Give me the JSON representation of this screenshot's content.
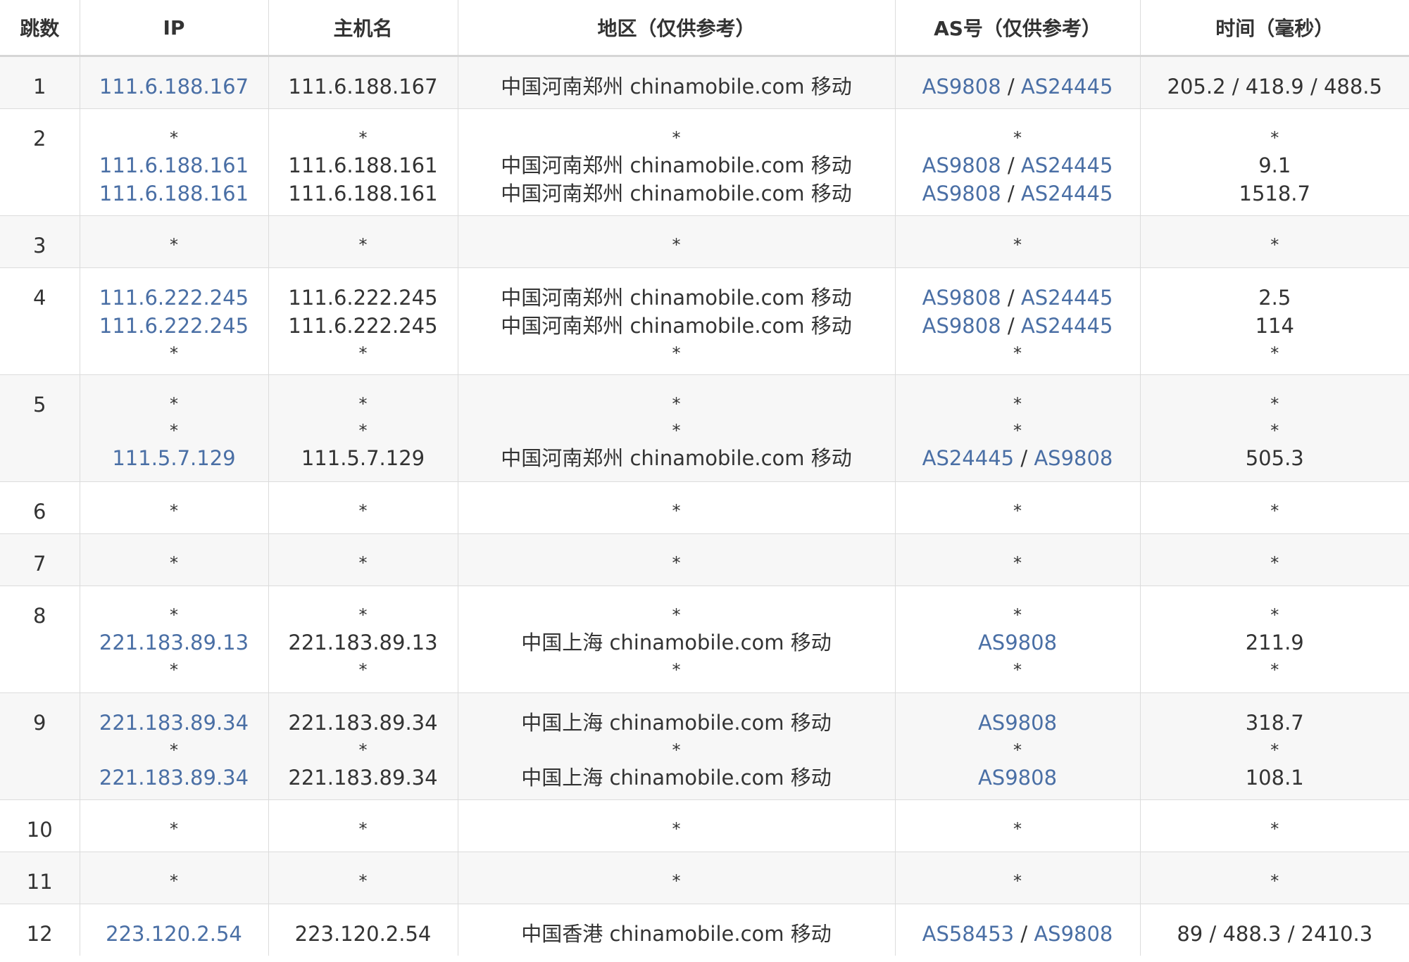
{
  "headers": {
    "hop": "跳数",
    "ip": "IP",
    "host": "主机名",
    "region": "地区（仅供参考）",
    "as": "AS号（仅供参考）",
    "time": "时间（毫秒）"
  },
  "colors": {
    "link": "#4a6fa5",
    "text": "#333333",
    "row_shade": "#f7f7f7",
    "border": "#dcdcdc"
  },
  "hops": [
    {
      "num": "1",
      "entries": [
        {
          "ip": "111.6.188.167",
          "host": "111.6.188.167",
          "region": "中国河南郑州 chinamobile.com 移动",
          "as": [
            "AS9808",
            "AS24445"
          ],
          "time": "205.2 / 418.9 / 488.5"
        }
      ]
    },
    {
      "num": "2",
      "entries": [
        {
          "ip": "*",
          "host": "*",
          "region": "*",
          "as": [],
          "time": "*"
        },
        {
          "ip": "111.6.188.161",
          "host": "111.6.188.161",
          "region": "中国河南郑州 chinamobile.com 移动",
          "as": [
            "AS9808",
            "AS24445"
          ],
          "time": "9.1"
        },
        {
          "ip": "111.6.188.161",
          "host": "111.6.188.161",
          "region": "中国河南郑州 chinamobile.com 移动",
          "as": [
            "AS9808",
            "AS24445"
          ],
          "time": "1518.7"
        }
      ]
    },
    {
      "num": "3",
      "entries": [
        {
          "ip": "*",
          "host": "*",
          "region": "*",
          "as": [],
          "time": "*"
        }
      ]
    },
    {
      "num": "4",
      "entries": [
        {
          "ip": "111.6.222.245",
          "host": "111.6.222.245",
          "region": "中国河南郑州 chinamobile.com 移动",
          "as": [
            "AS9808",
            "AS24445"
          ],
          "time": "2.5"
        },
        {
          "ip": "111.6.222.245",
          "host": "111.6.222.245",
          "region": "中国河南郑州 chinamobile.com 移动",
          "as": [
            "AS9808",
            "AS24445"
          ],
          "time": "114"
        },
        {
          "ip": "*",
          "host": "*",
          "region": "*",
          "as": [],
          "time": "*"
        }
      ]
    },
    {
      "num": "5",
      "entries": [
        {
          "ip": "*",
          "host": "*",
          "region": "*",
          "as": [],
          "time": "*"
        },
        {
          "ip": "*",
          "host": "*",
          "region": "*",
          "as": [],
          "time": "*"
        },
        {
          "ip": "111.5.7.129",
          "host": "111.5.7.129",
          "region": "中国河南郑州 chinamobile.com 移动",
          "as": [
            "AS24445",
            "AS9808"
          ],
          "time": "505.3"
        }
      ]
    },
    {
      "num": "6",
      "entries": [
        {
          "ip": "*",
          "host": "*",
          "region": "*",
          "as": [],
          "time": "*"
        }
      ]
    },
    {
      "num": "7",
      "entries": [
        {
          "ip": "*",
          "host": "*",
          "region": "*",
          "as": [],
          "time": "*"
        }
      ]
    },
    {
      "num": "8",
      "entries": [
        {
          "ip": "*",
          "host": "*",
          "region": "*",
          "as": [],
          "time": "*"
        },
        {
          "ip": "221.183.89.13",
          "host": "221.183.89.13",
          "region": "中国上海 chinamobile.com 移动",
          "as": [
            "AS9808"
          ],
          "time": "211.9"
        },
        {
          "ip": "*",
          "host": "*",
          "region": "*",
          "as": [],
          "time": "*"
        }
      ]
    },
    {
      "num": "9",
      "entries": [
        {
          "ip": "221.183.89.34",
          "host": "221.183.89.34",
          "region": "中国上海 chinamobile.com 移动",
          "as": [
            "AS9808"
          ],
          "time": "318.7"
        },
        {
          "ip": "*",
          "host": "*",
          "region": "*",
          "as": [],
          "time": "*"
        },
        {
          "ip": "221.183.89.34",
          "host": "221.183.89.34",
          "region": "中国上海 chinamobile.com 移动",
          "as": [
            "AS9808"
          ],
          "time": "108.1"
        }
      ]
    },
    {
      "num": "10",
      "entries": [
        {
          "ip": "*",
          "host": "*",
          "region": "*",
          "as": [],
          "time": "*"
        }
      ]
    },
    {
      "num": "11",
      "entries": [
        {
          "ip": "*",
          "host": "*",
          "region": "*",
          "as": [],
          "time": "*"
        }
      ]
    },
    {
      "num": "12",
      "entries": [
        {
          "ip": "223.120.2.54",
          "host": "223.120.2.54",
          "region": "中国香港 chinamobile.com 移动",
          "as": [
            "AS58453",
            "AS9808"
          ],
          "time": "89 / 488.3 / 2410.3"
        }
      ]
    }
  ]
}
